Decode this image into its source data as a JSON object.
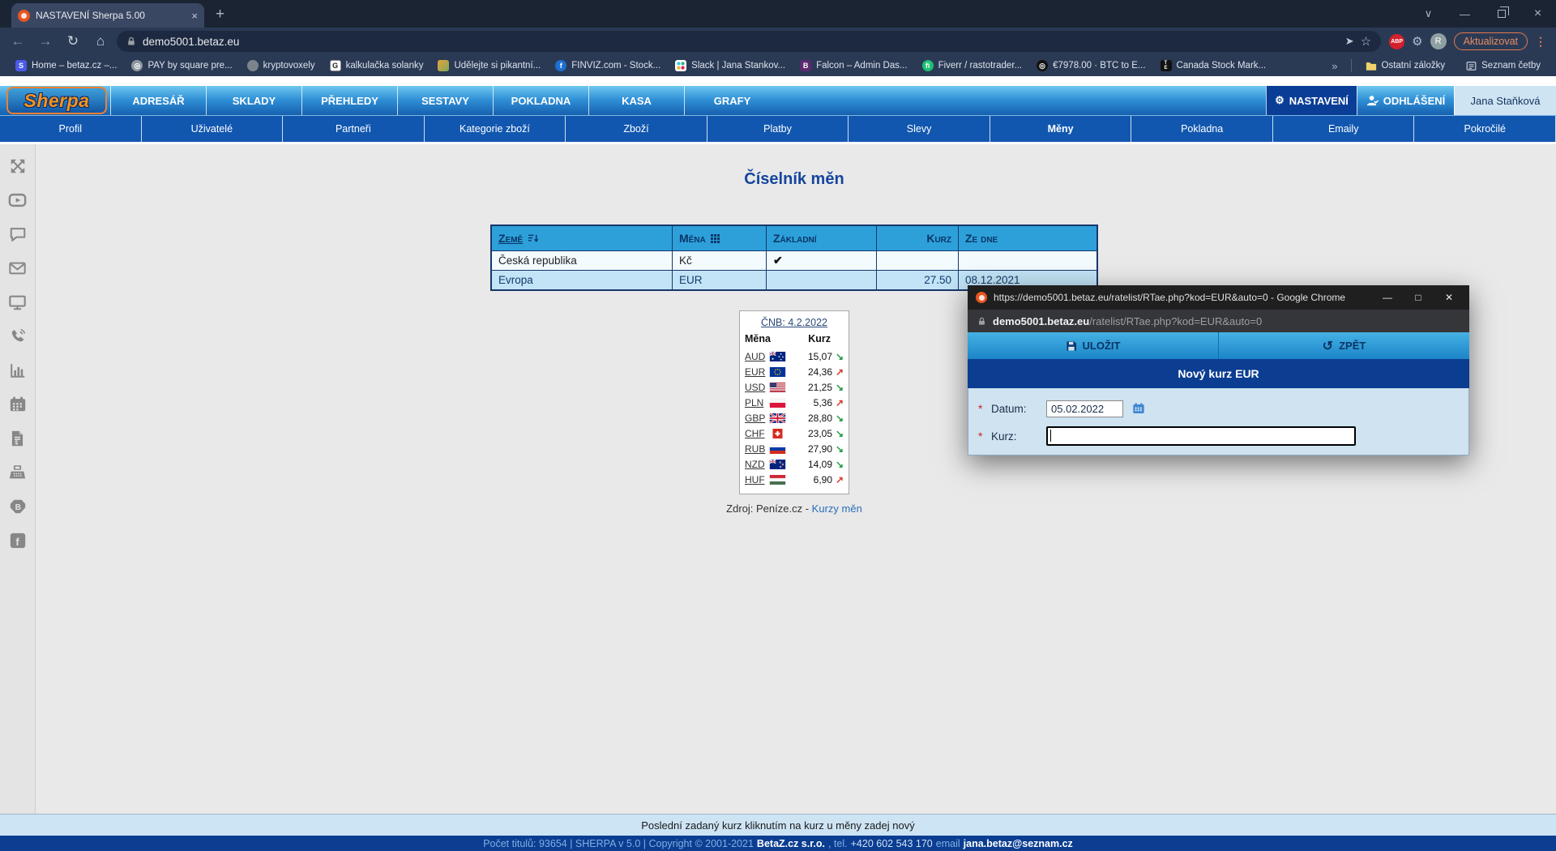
{
  "colors": {
    "header_navy": "#0b3d91",
    "nav_blue_gradient_top": "#6ec7ef",
    "nav_blue_gradient_bottom": "#1660ae",
    "subnav_blue": "#1157b0",
    "table_header_blue": "#2da0da",
    "table_row_alt_blue": "#c2e4f6",
    "panel_light_blue": "#cfe3f1",
    "logo_orange": "#f6921e",
    "trend_down_green": "#1f9d3f",
    "trend_up_red": "#d33b2a",
    "update_orange": "#e2794f"
  },
  "browser": {
    "tab_title": "NASTAVENÍ Sherpa 5.00",
    "new_tab": "+",
    "url": "demo5001.betaz.eu",
    "send_icon": "➤",
    "star_icon": "☆",
    "abp_label": "ABP",
    "avatar_letter": "R",
    "update_button": "Aktualizovat",
    "menu_dots": "⋮",
    "back": "←",
    "forward": "→",
    "reload": "↻",
    "home": "⌂",
    "tab_chevron": "∨",
    "minimize": "—",
    "close": "×",
    "bookmarks": [
      "Home – betaz.cz –...",
      "PAY by square pre...",
      "kryptovoxely",
      "kalkulačka solanky",
      "Udělejte si pikantní...",
      "FINVIZ.com - Stock...",
      "Slack | Jana Stankov...",
      "Falcon – Admin Das...",
      "Fiverr / rastotrader...",
      "€7978.00 · BTC to E...",
      "Canada Stock Mark..."
    ],
    "bookmarks_overflow": "»",
    "other_bookmarks": "Ostatní záložky",
    "reading_list": "Seznam četby"
  },
  "appnav": {
    "logo": "Sherpa",
    "items": [
      "ADRESÁŘ",
      "SKLADY",
      "PŘEHLEDY",
      "SESTAVY",
      "POKLADNA",
      "KASA",
      "GRAFY"
    ],
    "settings": "NASTAVENÍ",
    "gear": "⚙",
    "logout": "ODHLÁŠENÍ",
    "user": "Jana Staňková"
  },
  "subnav": {
    "items": [
      "Profil",
      "Uživatelé",
      "Partneři",
      "Kategorie zboží",
      "Zboží",
      "Platby",
      "Slevy",
      "Měny",
      "Pokladna",
      "Emaily",
      "Pokročilé"
    ],
    "active": "Měny"
  },
  "main": {
    "title": "Číselník měn",
    "table": {
      "headers": [
        "Země",
        "Měna",
        "Základní",
        "Kurz",
        "Ze dne"
      ],
      "rows": [
        {
          "country": "Česká republika",
          "currency": "Kč",
          "base": "✔",
          "rate": "",
          "date": ""
        },
        {
          "country": "Evropa",
          "currency": "EUR",
          "base": "",
          "rate": "27.50",
          "date": "08.12.2021"
        }
      ]
    },
    "cnb": {
      "title": "ČNB: 4.2.2022",
      "col_currency": "Měna",
      "col_rate": "Kurz",
      "rows": [
        {
          "code": "AUD",
          "rate": "15,07",
          "trend": "down",
          "arrow": "↘"
        },
        {
          "code": "EUR",
          "rate": "24,36",
          "trend": "up",
          "arrow": "↗"
        },
        {
          "code": "USD",
          "rate": "21,25",
          "trend": "down",
          "arrow": "↘"
        },
        {
          "code": "PLN",
          "rate": "5,36",
          "trend": "up",
          "arrow": "↗"
        },
        {
          "code": "GBP",
          "rate": "28,80",
          "trend": "down",
          "arrow": "↘"
        },
        {
          "code": "CHF",
          "rate": "23,05",
          "trend": "down",
          "arrow": "↘"
        },
        {
          "code": "RUB",
          "rate": "27,90",
          "trend": "down",
          "arrow": "↘"
        },
        {
          "code": "NZD",
          "rate": "14,09",
          "trend": "down",
          "arrow": "↘"
        },
        {
          "code": "HUF",
          "rate": "6,90",
          "trend": "up",
          "arrow": "↗"
        }
      ],
      "source_prefix": "Zdroj: Peníze.cz -",
      "source_link": "Kurzy měn"
    }
  },
  "popup": {
    "window_title": "https://demo5001.betaz.eu/ratelist/RTae.php?kod=EUR&auto=0 - Google Chrome",
    "minimize": "—",
    "maximize": "□",
    "close": "✕",
    "url_domain": "demo5001.betaz.eu",
    "url_path": "/ratelist/RTae.php?kod=EUR&auto=0",
    "save_label": "ULOŽIT",
    "back_label": "ZPĚT",
    "undo_glyph": "↺",
    "header": "Nový kurz EUR",
    "required_mark": "*",
    "date_label": "Datum:",
    "date_value": "05.02.2022",
    "rate_label": "Kurz:",
    "rate_value": ""
  },
  "footer": {
    "hint": "Poslední zadaný kurz kliknutím na kurz u měny zadej nový",
    "left": "Počet titulů: 93654 | SHERPA v 5.0 | Copyright © 2001-2021",
    "company": "BetaZ.cz s.r.o.",
    "tel_label": ", tel.",
    "phone": "+420 602 543 170",
    "email_label": "email",
    "email": "jana.betaz@seznam.cz"
  }
}
